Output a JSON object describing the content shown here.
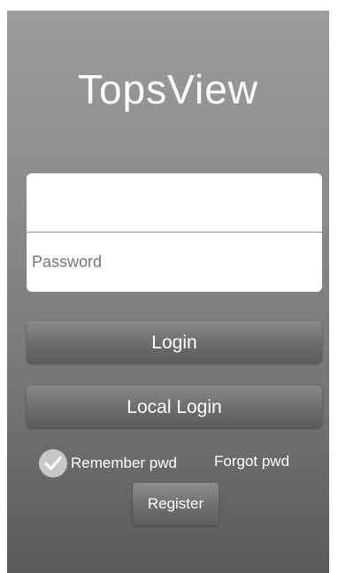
{
  "app": {
    "title": "TopsView"
  },
  "form": {
    "username": {
      "value": "",
      "placeholder": ""
    },
    "password": {
      "value": "",
      "placeholder": "Password"
    }
  },
  "buttons": {
    "login_label": "Login",
    "local_login_label": "Local Login",
    "register_label": "Register"
  },
  "options": {
    "remember_label": "Remember pwd",
    "remember_checked": true,
    "forgot_label": "Forgot pwd"
  },
  "icons": {
    "checkbox": "checkmark-icon"
  },
  "colors": {
    "background_top": "#9c9c9e",
    "background_bottom": "#5a5a5c",
    "button": "#6c6c6e",
    "checkbox": "#c8c8ca",
    "text": "#ffffff"
  }
}
